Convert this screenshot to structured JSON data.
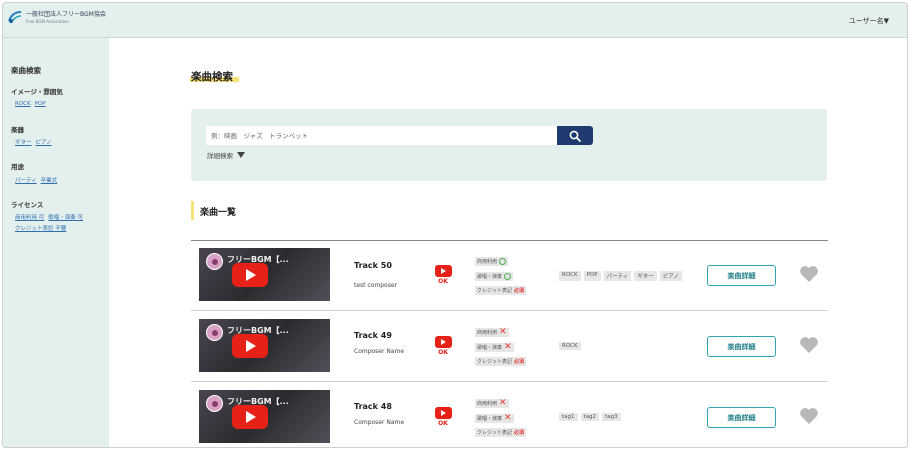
{
  "header": {
    "org_name": "一般社団法人フリーBGM協会",
    "org_sub": "Free BGM Association",
    "user_menu": "ユーザー名▼"
  },
  "sidebar": {
    "heading": "楽曲検索",
    "categories": [
      {
        "label": "イメージ・雰囲気",
        "links": [
          "ROCK",
          "POP"
        ]
      },
      {
        "label": "楽器",
        "links": [
          "ギター",
          "ピアノ"
        ]
      },
      {
        "label": "用途",
        "links": [
          "パーティ",
          "卒業式"
        ]
      },
      {
        "label": "ライセンス",
        "links": [
          "商用利用 可",
          "歌唱・演奏 可"
        ],
        "links2": [
          "クレジット表記 不要"
        ]
      }
    ]
  },
  "main": {
    "title": "楽曲検索",
    "search": {
      "placeholder": "例：映画　ジャズ　トランペット"
    },
    "advanced_search": "詳細検索",
    "list_title": "楽曲一覧"
  },
  "tracks": [
    {
      "thumb_title": "フリーBGM【...",
      "title": "Track 50",
      "composer": "test composer",
      "ok_label": "OK",
      "license": {
        "commercial": "商用利用",
        "commercial_ok": true,
        "singing": "歌唱・演奏",
        "singing_ok": true,
        "credit": "クレジット表記",
        "credit_req": "必須"
      },
      "tags": [
        "ROCK",
        "POP",
        "パーティ",
        "ギター",
        "ピアノ"
      ],
      "detail_label": "楽曲詳細"
    },
    {
      "thumb_title": "フリーBGM【...",
      "title": "Track 49",
      "composer": "Composer Name",
      "ok_label": "OK",
      "license": {
        "commercial": "商用利用",
        "commercial_ok": false,
        "singing": "歌唱・演奏",
        "singing_ok": false,
        "credit": "クレジット表記",
        "credit_req": "必須"
      },
      "tags": [
        "ROCK"
      ],
      "detail_label": "楽曲詳細"
    },
    {
      "thumb_title": "フリーBGM【...",
      "title": "Track 48",
      "composer": "Composer Name",
      "ok_label": "OK",
      "license": {
        "commercial": "商用利用",
        "commercial_ok": false,
        "singing": "歌唱・演奏",
        "singing_ok": false,
        "credit": "クレジット表記",
        "credit_req": "必須"
      },
      "tags": [
        "tag1",
        "tag2",
        "tag3"
      ],
      "detail_label": "楽曲詳細"
    }
  ],
  "colors": {
    "accent_bg": "#e4f0ee",
    "search_button": "#1f3a6e",
    "highlight": "#f7e27a",
    "detail_border": "#2ea5b0",
    "youtube_red": "#e62117"
  }
}
